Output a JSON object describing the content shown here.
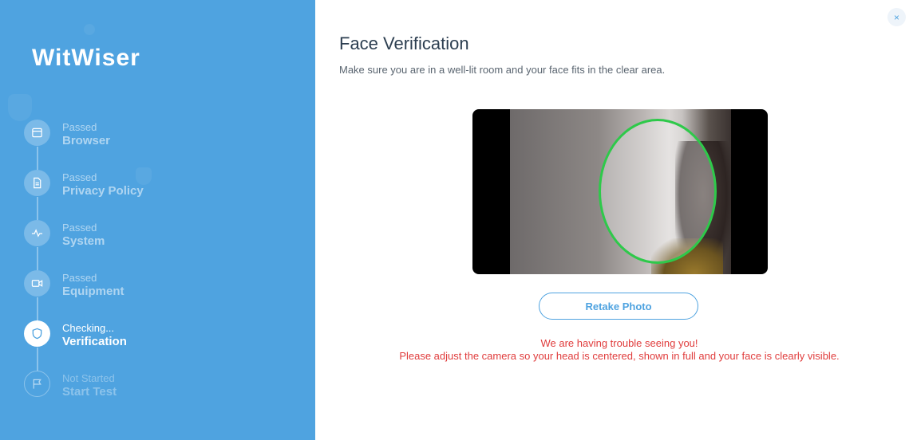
{
  "sidebar": {
    "logo_text": "WitWiser",
    "steps": [
      {
        "status": "Passed",
        "name": "Browser",
        "icon": "browser-icon"
      },
      {
        "status": "Passed",
        "name": "Privacy Policy",
        "icon": "document-icon"
      },
      {
        "status": "Passed",
        "name": "System",
        "icon": "activity-icon"
      },
      {
        "status": "Passed",
        "name": "Equipment",
        "icon": "video-camera-icon"
      },
      {
        "status": "Checking...",
        "name": "Verification",
        "icon": "shield-icon"
      },
      {
        "status": "Not Started",
        "name": "Start Test",
        "icon": "flag-icon"
      }
    ]
  },
  "main": {
    "close_label": "×",
    "title": "Face Verification",
    "subtitle": "Make sure you are in a well-lit room and your face fits in the clear area.",
    "retake_label": "Retake Photo",
    "error_line1": "We are having trouble seeing you!",
    "error_line2": "Please adjust the camera so your head is centered, shown in full and your face is clearly visible."
  },
  "colors": {
    "sidebar_bg": "#4fa3e0",
    "accent": "#4fa3e0",
    "error": "#e03c3c",
    "face_guide": "#2ec94a"
  }
}
